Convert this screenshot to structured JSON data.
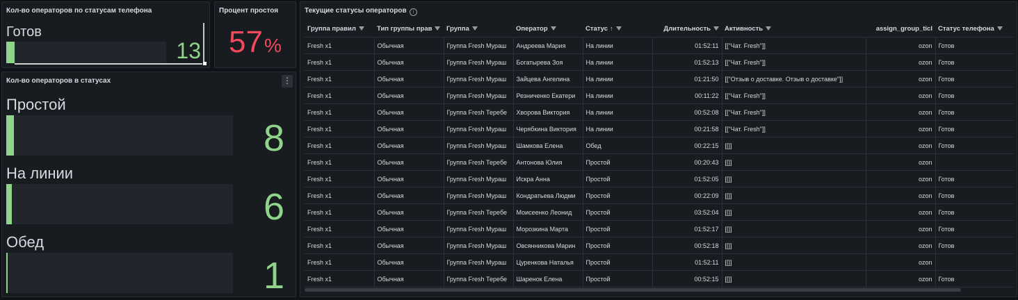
{
  "panel1": {
    "title": "Кол-во операторов по статусам телефона",
    "label": "Готов",
    "value": "13"
  },
  "panel2": {
    "title": "Процент простоя",
    "value": "57",
    "unit": "%"
  },
  "panel3": {
    "title": "Кол-во операторов в статусах",
    "menu": "⋮",
    "rows": [
      {
        "label": "Простой",
        "value": "8"
      },
      {
        "label": "На линии",
        "value": "6"
      },
      {
        "label": "Обед",
        "value": "1"
      }
    ]
  },
  "panel4": {
    "title": "Текущие статусы операторов",
    "info": "i",
    "columns": [
      "Группа правил",
      "Тип группы прав",
      "Группа",
      "Оператор",
      "Статус",
      "Длительность",
      "Активность",
      "assign_group_ticl",
      "Статус телефона"
    ],
    "sort_arrow": "↑",
    "rows": [
      [
        "Fresh x1",
        "Обычная",
        "Группа Fresh Мураш",
        "Андреева Мария",
        "На линии",
        "01:52:11",
        "[[\"Чат. Fresh\"]]",
        "ozon",
        "Готов"
      ],
      [
        "Fresh x1",
        "Обычная",
        "Группа Fresh Мураш",
        "Богатырева Зоя",
        "На линии",
        "01:52:13",
        "[[\"Чат. Fresh\"]]",
        "ozon",
        "Готов"
      ],
      [
        "Fresh x1",
        "Обычная",
        "Группа Fresh Мураш",
        "Зайцева Ангелина",
        "На линии",
        "01:21:50",
        "[[\"Отзыв о доставке. Отзыв о доставке\"]]",
        "ozon",
        "Готов"
      ],
      [
        "Fresh x1",
        "Обычная",
        "Группа Fresh Мураш",
        "Резниченко Екатери",
        "На линии",
        "00:11:22",
        "[[\"Чат. Fresh\"]]",
        "ozon",
        "Готов"
      ],
      [
        "Fresh x1",
        "Обычная",
        "Группа Fresh Теребе",
        "Хворова Виктория",
        "На линии",
        "00:52:08",
        "[[\"Чат. Fresh\"]]",
        "ozon",
        "Готов"
      ],
      [
        "Fresh x1",
        "Обычная",
        "Группа Fresh Мураш",
        "Черябкина Виктория",
        "На линии",
        "00:21:58",
        "[[\"Чат. Fresh\"]]",
        "ozon",
        "Готов"
      ],
      [
        "Fresh x1",
        "Обычная",
        "Группа Fresh Мураш",
        "Шамкова Елена",
        "Обед",
        "00:22:15",
        "[[]]",
        "ozon",
        "Готов"
      ],
      [
        "Fresh x1",
        "Обычная",
        "Группа Fresh Теребе",
        "Антонова Юлия",
        "Простой",
        "00:20:43",
        "[[]]",
        "ozon",
        ""
      ],
      [
        "Fresh x1",
        "Обычная",
        "Группа Fresh Мураш",
        "Искра Анна",
        "Простой",
        "01:52:05",
        "[[]]",
        "ozon",
        "Готов"
      ],
      [
        "Fresh x1",
        "Обычная",
        "Группа Fresh Мураш",
        "Кондратьева Людми",
        "Простой",
        "00:22:09",
        "[[]]",
        "ozon",
        "Готов"
      ],
      [
        "Fresh x1",
        "Обычная",
        "Группа Fresh Теребе",
        "Моисеенко Леонид",
        "Простой",
        "03:52:04",
        "[[]]",
        "ozon",
        "Готов"
      ],
      [
        "Fresh x1",
        "Обычная",
        "Группа Fresh Мураш",
        "Морозкина Марта",
        "Простой",
        "01:52:17",
        "[[]]",
        "ozon",
        "Готов"
      ],
      [
        "Fresh x1",
        "Обычная",
        "Группа Fresh Мураш",
        "Овсянникова Марин",
        "Простой",
        "00:52:18",
        "[[]]",
        "ozon",
        "Готов"
      ],
      [
        "Fresh x1",
        "Обычная",
        "Группа Fresh Мураш",
        "Цуренкова Наталья",
        "Простой",
        "01:52:11",
        "[[]]",
        "ozon",
        ""
      ],
      [
        "Fresh x1",
        "Обычная",
        "Группа Fresh Теребе",
        "Шаренок Елена",
        "Простой",
        "00:52:15",
        "[[]]",
        "ozon",
        "Готов"
      ]
    ]
  },
  "colors": {
    "accent_green": "#8fd48a",
    "accent_red": "#f2495c",
    "panel_bg": "#181b1f",
    "page_bg": "#111217"
  }
}
